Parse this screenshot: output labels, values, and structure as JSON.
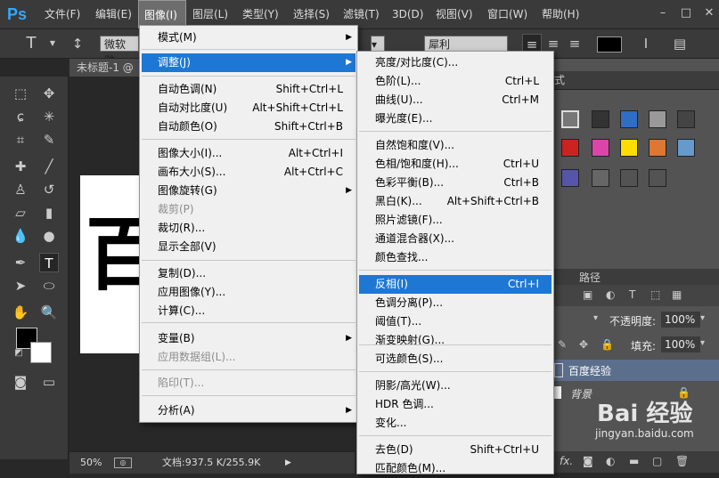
{
  "menubar": {
    "logo": "Ps",
    "items": [
      "文件(F)",
      "编辑(E)",
      "图像(I)",
      "图层(L)",
      "类型(Y)",
      "选择(S)",
      "滤镜(T)",
      "3D(D)",
      "视图(V)",
      "窗口(W)",
      "帮助(H)"
    ],
    "active": "图像(I)"
  },
  "optbar": {
    "font_family": "微软雅...",
    "aa_label": "a",
    "aa_mode": "犀利"
  },
  "document": {
    "tab_title": "未标题-1 @",
    "zoom": "50%",
    "doc_info": "文档:937.5 K/255.9K",
    "canvas_char": "百"
  },
  "panels": {
    "styles_tab": "式",
    "paths_tab": "路径",
    "opacity_label": "不透明度:",
    "opacity_value": "100%",
    "fill_label": "填充:",
    "fill_value": "100%",
    "layer1_name": "百度经验",
    "layer2_name": "背景",
    "watermark": "Bai 经验",
    "watermark_url": "jingyan.baidu.com",
    "fx_label": "fx."
  },
  "image_menu": {
    "items": [
      {
        "label": "模式(M)",
        "shortcut": "",
        "submenu": true,
        "disabled": false
      },
      {
        "label": "调整(J)",
        "shortcut": "",
        "submenu": true,
        "disabled": false,
        "highlight": true
      },
      {
        "label": "自动色调(N)",
        "shortcut": "Shift+Ctrl+L",
        "disabled": false
      },
      {
        "label": "自动对比度(U)",
        "shortcut": "Alt+Shift+Ctrl+L",
        "disabled": false
      },
      {
        "label": "自动颜色(O)",
        "shortcut": "Shift+Ctrl+B",
        "disabled": false
      },
      {
        "label": "图像大小(I)...",
        "shortcut": "Alt+Ctrl+I",
        "disabled": false
      },
      {
        "label": "画布大小(S)...",
        "shortcut": "Alt+Ctrl+C",
        "disabled": false
      },
      {
        "label": "图像旋转(G)",
        "shortcut": "",
        "submenu": true,
        "disabled": false
      },
      {
        "label": "裁剪(P)",
        "shortcut": "",
        "disabled": true
      },
      {
        "label": "裁切(R)...",
        "shortcut": "",
        "disabled": false
      },
      {
        "label": "显示全部(V)",
        "shortcut": "",
        "disabled": false
      },
      {
        "label": "复制(D)...",
        "shortcut": "",
        "disabled": false
      },
      {
        "label": "应用图像(Y)...",
        "shortcut": "",
        "disabled": false
      },
      {
        "label": "计算(C)...",
        "shortcut": "",
        "disabled": false
      },
      {
        "label": "变量(B)",
        "shortcut": "",
        "submenu": true,
        "disabled": false
      },
      {
        "label": "应用数据组(L)...",
        "shortcut": "",
        "disabled": true
      },
      {
        "label": "陷印(T)...",
        "shortcut": "",
        "disabled": true
      },
      {
        "label": "分析(A)",
        "shortcut": "",
        "submenu": true,
        "disabled": false
      }
    ]
  },
  "adjust_menu": {
    "items": [
      {
        "label": "亮度/对比度(C)...",
        "shortcut": ""
      },
      {
        "label": "色阶(L)...",
        "shortcut": "Ctrl+L"
      },
      {
        "label": "曲线(U)...",
        "shortcut": "Ctrl+M"
      },
      {
        "label": "曝光度(E)...",
        "shortcut": ""
      },
      {
        "label": "自然饱和度(V)...",
        "shortcut": ""
      },
      {
        "label": "色相/饱和度(H)...",
        "shortcut": "Ctrl+U"
      },
      {
        "label": "色彩平衡(B)...",
        "shortcut": "Ctrl+B"
      },
      {
        "label": "黑白(K)...",
        "shortcut": "Alt+Shift+Ctrl+B"
      },
      {
        "label": "照片滤镜(F)...",
        "shortcut": ""
      },
      {
        "label": "通道混合器(X)...",
        "shortcut": ""
      },
      {
        "label": "颜色查找...",
        "shortcut": ""
      },
      {
        "label": "反相(I)",
        "shortcut": "Ctrl+I",
        "highlight": true
      },
      {
        "label": "色调分离(P)...",
        "shortcut": ""
      },
      {
        "label": "阈值(T)...",
        "shortcut": ""
      },
      {
        "label": "渐变映射(G)...",
        "shortcut": ""
      },
      {
        "label": "可选颜色(S)...",
        "shortcut": ""
      },
      {
        "label": "阴影/高光(W)...",
        "shortcut": ""
      },
      {
        "label": "HDR 色调...",
        "shortcut": ""
      },
      {
        "label": "变化...",
        "shortcut": ""
      },
      {
        "label": "去色(D)",
        "shortcut": "Shift+Ctrl+U"
      },
      {
        "label": "匹配颜色(M)...",
        "shortcut": ""
      }
    ]
  },
  "colors": {
    "highlight": "#1e77d3",
    "ps_blue": "#31a8ff"
  }
}
